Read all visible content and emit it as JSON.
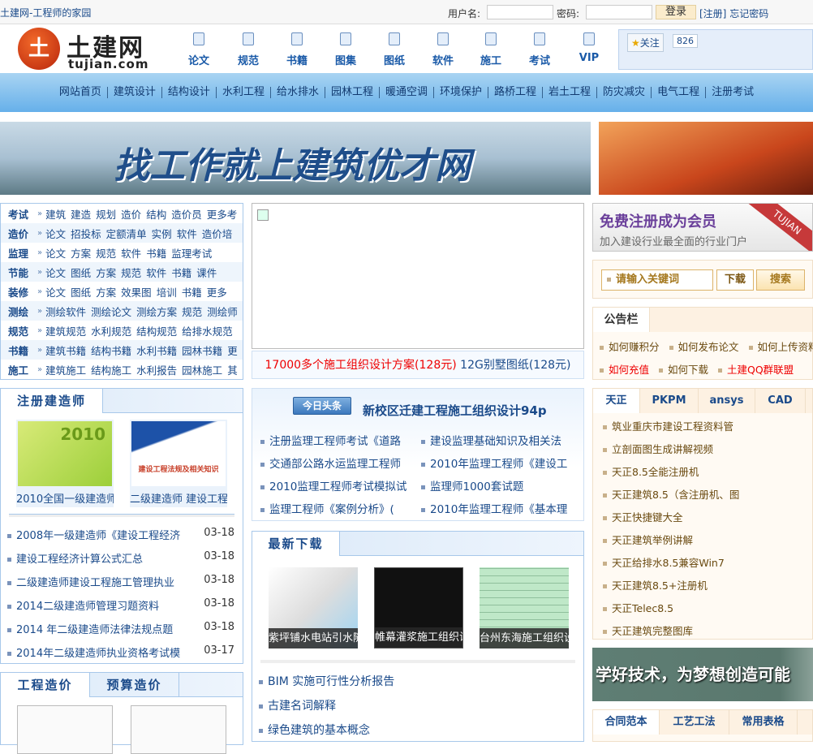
{
  "topbar": {
    "site_title": "土建网-工程师的家园",
    "username_label": "用户名:",
    "password_label": "密码:",
    "login_label": "登录",
    "register_label": "[注册]",
    "forgot_label": "忘记密码"
  },
  "logo": {
    "cn": "土建网",
    "en": "tujian.com",
    "mark": "土"
  },
  "icon_nav": [
    {
      "label": "论文",
      "icon": "document-icon"
    },
    {
      "label": "规范",
      "icon": "copy-icon"
    },
    {
      "label": "书籍",
      "icon": "book-icon"
    },
    {
      "label": "图集",
      "icon": "picture-icon"
    },
    {
      "label": "图纸",
      "icon": "drawing-icon"
    },
    {
      "label": "软件",
      "icon": "disc-icon"
    },
    {
      "label": "施工",
      "icon": "report-icon"
    },
    {
      "label": "考试",
      "icon": "play-icon"
    },
    {
      "label": "VIP",
      "icon": "grid-icon"
    }
  ],
  "follow": {
    "label": "关注",
    "count": "826"
  },
  "main_nav": [
    "网站首页",
    "建筑设计",
    "结构设计",
    "水利工程",
    "给水排水",
    "园林工程",
    "暖通空调",
    "环境保护",
    "路桥工程",
    "岩土工程",
    "防灾减灾",
    "电气工程",
    "注册考试"
  ],
  "banner": {
    "text": "找工作就上建筑优才网"
  },
  "categories": [
    {
      "name": "考试",
      "links": [
        "建筑",
        "建造",
        "规划",
        "造价",
        "结构",
        "造价员",
        "更多考"
      ]
    },
    {
      "name": "造价",
      "links": [
        "论文",
        "招投标",
        "定额清单",
        "实例",
        "软件",
        "造价培"
      ]
    },
    {
      "name": "监理",
      "links": [
        "论文",
        "方案",
        "规范",
        "软件",
        "书籍",
        "监理考试"
      ]
    },
    {
      "name": "节能",
      "links": [
        "论文",
        "图纸",
        "方案",
        "规范",
        "软件",
        "书籍",
        "课件"
      ]
    },
    {
      "name": "装修",
      "links": [
        "论文",
        "图纸",
        "方案",
        "效果图",
        "培训",
        "书籍",
        "更多"
      ]
    },
    {
      "name": "测绘",
      "links": [
        "测绘软件",
        "测绘论文",
        "测绘方案",
        "规范",
        "测绘师"
      ]
    },
    {
      "name": "规范",
      "links": [
        "建筑规范",
        "水利规范",
        "结构规范",
        "给排水规范"
      ]
    },
    {
      "name": "书籍",
      "links": [
        "建筑书籍",
        "结构书籍",
        "水利书籍",
        "园林书籍",
        "更"
      ]
    },
    {
      "name": "施工",
      "links": [
        "建筑施工",
        "结构施工",
        "水利报告",
        "园林施工",
        "其"
      ]
    }
  ],
  "category_arrow": "»",
  "ad_line": {
    "red": "17000多个施工组织设计方案(128元)",
    "blue": "12G别墅图纸(128元)"
  },
  "register_banner": {
    "title": "免费注册成为会员",
    "subtitle": "加入建设行业最全面的行业门户",
    "ribbon": "TUJIAN"
  },
  "search": {
    "placeholder": "请输入关键词",
    "download_label": "下载",
    "search_label": "搜索"
  },
  "notice": {
    "title": "公告栏",
    "row1": [
      "如何赚积分",
      "如何发布论文",
      "如何上传资料"
    ],
    "row2": [
      "如何充值",
      "如何下载",
      "土建QQ群联盟"
    ]
  },
  "jzs": {
    "tab": "注册建造师",
    "thumbs": [
      {
        "caption": "2010全国一级建造师",
        "cover": "2010"
      },
      {
        "caption": "二级建造师 建设工程",
        "cover": "建设工程法规及相关知识"
      }
    ],
    "list": [
      {
        "title": "2008年一级建造师《建设工程经济",
        "date": "03-18"
      },
      {
        "title": "建设工程经济计算公式汇总",
        "date": "03-18"
      },
      {
        "title": "二级建造师建设工程施工管理执业",
        "date": "03-18"
      },
      {
        "title": "2014二级建造师管理习题资料",
        "date": "03-18"
      },
      {
        "title": "2014 年二级建造师法律法规点题",
        "date": "03-18"
      },
      {
        "title": "2014年二级建造师执业资格考试模",
        "date": "03-17"
      }
    ]
  },
  "zj": {
    "tabs": [
      "工程造价",
      "预算造价"
    ]
  },
  "toutiao": {
    "badge": "今日头条",
    "headline": "新校区迁建工程施工组织设计94p",
    "left": [
      "注册监理工程师考试《道路",
      "交通部公路水运监理工程师",
      "2010监理工程师考试模拟试",
      "监理工程师《案例分析》("
    ],
    "right": [
      "建设监理基础知识及相关法",
      "2010年监理工程师《建设工",
      "监理师1000套试题",
      "2010年监理工程师《基本理"
    ]
  },
  "downloads": {
    "tab": "最新下载",
    "thumbs": [
      "紫坪铺水电站引水隧",
      "帷幕灌浆施工组织设",
      "台州东海施工组织设"
    ],
    "list": [
      "BIM 实施可行性分析报告",
      "古建名词解释",
      "绿色建筑的基本概念"
    ]
  },
  "soft": {
    "tabs": [
      "天正",
      "PKPM",
      "ansys",
      "CAD"
    ],
    "list": [
      "筑业重庆市建设工程资料管",
      "立剖面图生成讲解视频",
      "天正8.5全能注册机",
      "天正建筑8.5（含注册机、图",
      "天正快捷键大全",
      "天正建筑举例讲解",
      "天正给排水8.5兼容Win7",
      "天正建筑8.5+注册机",
      "天正Telec8.5",
      "天正建筑完整图库"
    ]
  },
  "banner3": {
    "text": "学好技术，为梦想创造可能"
  },
  "ref_tabs": [
    "合同范本",
    "工艺工法",
    "常用表格"
  ],
  "colors": {
    "link": "#1a4a8a",
    "red": "#ee0000",
    "nav_bg": "#66b0ea"
  }
}
